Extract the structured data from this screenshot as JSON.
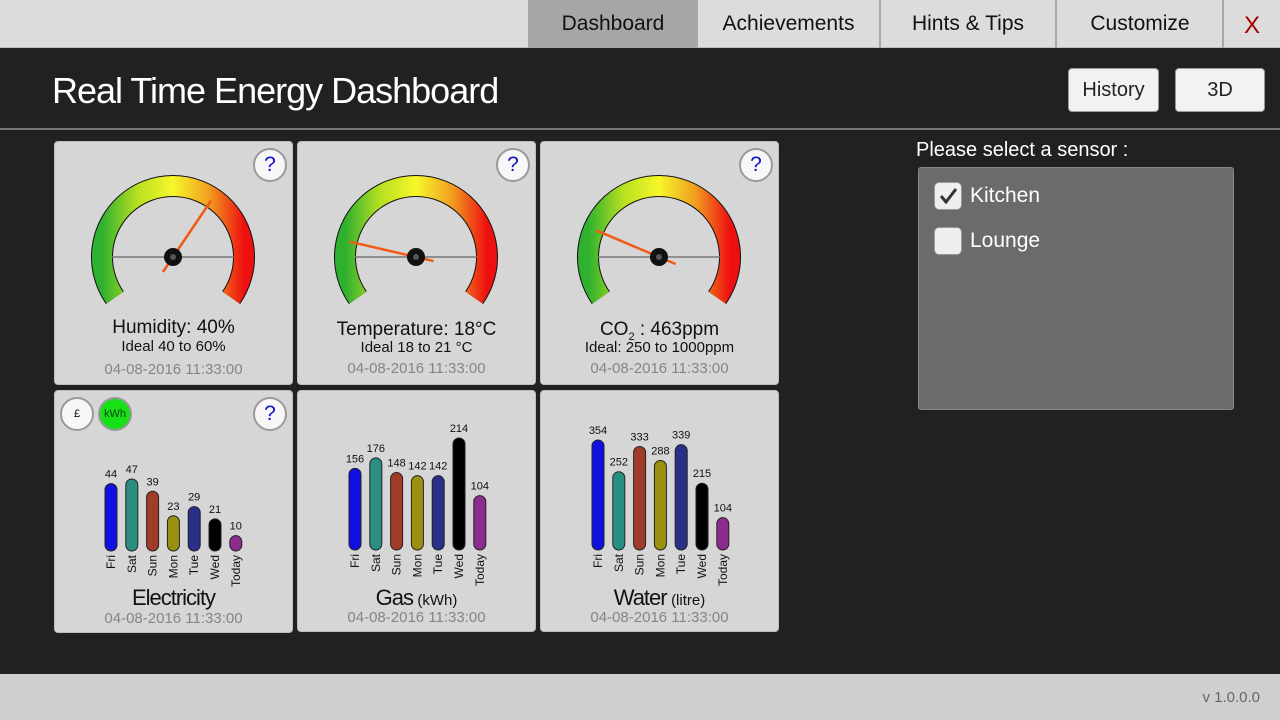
{
  "nav": {
    "tabs": [
      {
        "label": "Dashboard",
        "active": true
      },
      {
        "label": "Achievements",
        "active": false
      },
      {
        "label": "Hints & Tips",
        "active": false
      },
      {
        "label": "Customize",
        "active": false
      }
    ],
    "close_label": "X"
  },
  "header": {
    "title": "Real Time Energy Dashboard",
    "history_label": "History",
    "threed_label": "3D"
  },
  "help_label": "?",
  "gauges": [
    {
      "name": "humidity",
      "label": "Humidity:  40%",
      "ideal": "Ideal 40 to 60%",
      "timestamp": "04-08-2016 11:33:00",
      "value": 40,
      "needle_angle_deg": 56
    },
    {
      "name": "temperature",
      "label": "Temperature: 18°C",
      "ideal": "Ideal 18 to 21 °C",
      "timestamp": "04-08-2016 11:33:00",
      "value": 18,
      "needle_angle_deg": 167
    },
    {
      "name": "co2",
      "label_main": "CO",
      "label_sub": "2",
      "label_rest": " : 463ppm",
      "ideal": "Ideal: 250 to 1000ppm",
      "timestamp": "04-08-2016 11:33:00",
      "value": 463,
      "needle_angle_deg": 157
    }
  ],
  "unit_toggle": {
    "pound_label": "£",
    "kwh_label": "kWh",
    "active": "kWh"
  },
  "days": [
    "Fri",
    "Sat",
    "Sun",
    "Mon",
    "Tue",
    "Wed",
    "Today"
  ],
  "bar_colors": [
    "#1010e0",
    "#2a8f80",
    "#a23c2a",
    "#98900e",
    "#2a2f8a",
    "#000000",
    "#8c2c8f"
  ],
  "chart_data": [
    {
      "type": "bar",
      "title": "Electricity",
      "unit": "",
      "categories": [
        "Fri",
        "Sat",
        "Sun",
        "Mon",
        "Tue",
        "Wed",
        "Today"
      ],
      "values": [
        44,
        47,
        39,
        23,
        29,
        21,
        10
      ],
      "timestamp": "04-08-2016 11:33:00"
    },
    {
      "type": "bar",
      "title": "Gas",
      "unit": "(kWh)",
      "categories": [
        "Fri",
        "Sat",
        "Sun",
        "Mon",
        "Tue",
        "Wed",
        "Today"
      ],
      "values": [
        156,
        176,
        148,
        142,
        142,
        214,
        104
      ],
      "timestamp": "04-08-2016 11:33:00"
    },
    {
      "type": "bar",
      "title": "Water",
      "unit": "(litre)",
      "categories": [
        "Fri",
        "Sat",
        "Sun",
        "Mon",
        "Tue",
        "Wed",
        "Today"
      ],
      "values": [
        354,
        252,
        333,
        288,
        339,
        215,
        104
      ],
      "timestamp": "04-08-2016 11:33:00"
    }
  ],
  "sensor": {
    "prompt": "Please select a sensor :",
    "options": [
      {
        "label": "Kitchen",
        "checked": true
      },
      {
        "label": "Lounge",
        "checked": false
      }
    ]
  },
  "footer": {
    "version": "v 1.0.0.0"
  }
}
